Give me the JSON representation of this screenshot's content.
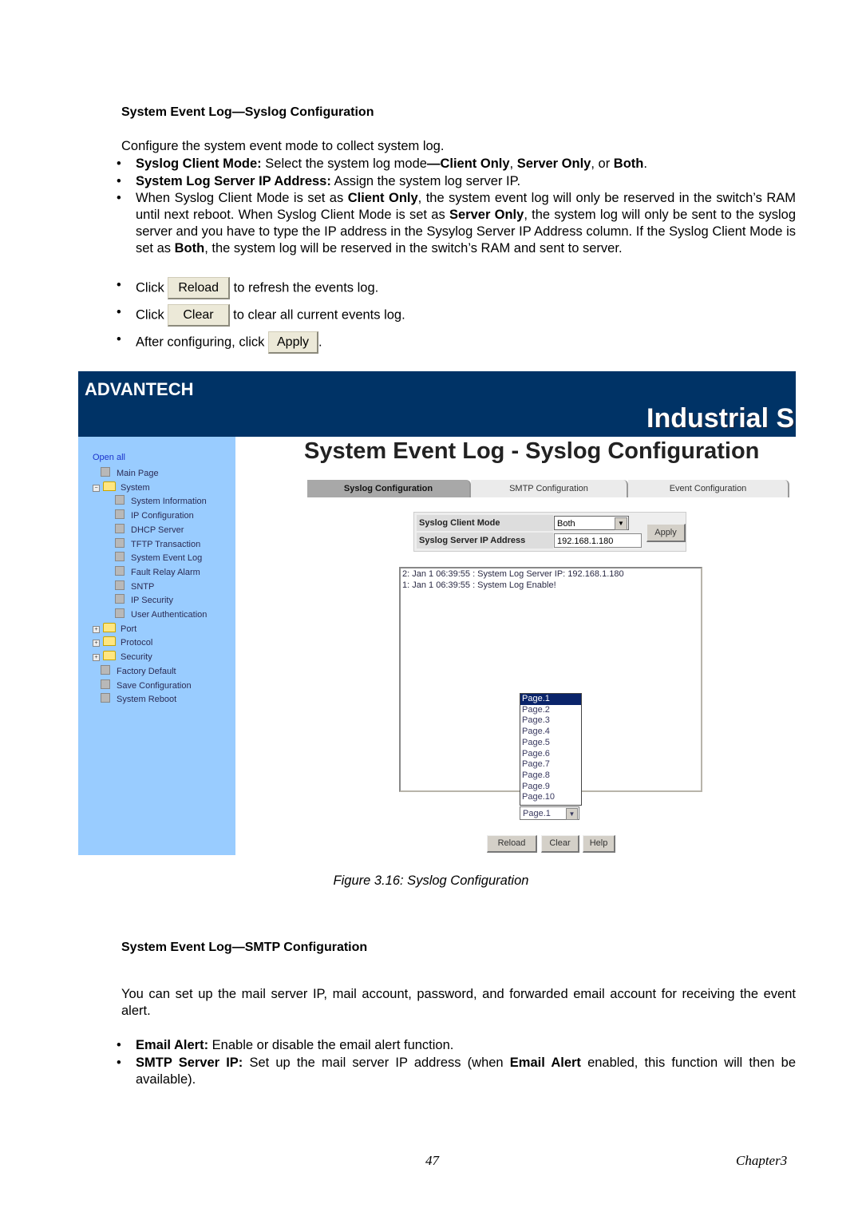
{
  "section1": {
    "heading": "System Event Log—Syslog Configuration",
    "intro": "Configure the system event mode to collect system log.",
    "bullets": {
      "b1_bold": "Syslog Client Mode:",
      "b1_text": " Select the system log mode",
      "b1_bold2": "—Client Only",
      "b1_sep1": ", ",
      "b1_bold3": "Server Only",
      "b1_sep2": ", or ",
      "b1_bold4": "Both",
      "b1_end": ".",
      "b2_bold": "System Log Server IP Address:",
      "b2_text": " Assign the system log server IP.",
      "b3_a": "When Syslog Client Mode is set as ",
      "b3_bold1": "Client Only",
      "b3_b": ", the system event log will only be reserved in the switch’s RAM until next reboot. When Syslog Client Mode is set as ",
      "b3_bold2": "Server Only",
      "b3_c": ", the system log will only be sent to the syslog server and you have to type the IP address in the Sysylog Server IP Address column. If the Syslog Client Mode is set as ",
      "b3_bold3": "Both",
      "b3_d": ", the system log will be reserved in the switch’s RAM and sent to server.",
      "b4_pre": "Click",
      "b4_btn": "Reload",
      "b4_post": "to refresh the events log.",
      "b5_pre": "Click",
      "b5_btn": "Clear",
      "b5_post": "to clear all current events log.",
      "b6_pre": "After configuring, click",
      "b6_btn": "Apply",
      "b6_post": "."
    }
  },
  "screenshot": {
    "logo": "ADVANTECH",
    "banner_title": "Industrial S",
    "page_title": "System Event Log - Syslog Configuration",
    "sidebar": {
      "open_all": "Open all",
      "items": [
        {
          "label": "Main Page",
          "type": "page",
          "level": 1
        },
        {
          "label": "System",
          "type": "folder-open",
          "level": 0
        },
        {
          "label": "System Information",
          "type": "page",
          "level": 2
        },
        {
          "label": "IP Configuration",
          "type": "page",
          "level": 2
        },
        {
          "label": "DHCP Server",
          "type": "page",
          "level": 2
        },
        {
          "label": "TFTP Transaction",
          "type": "page",
          "level": 2
        },
        {
          "label": "System Event Log",
          "type": "page",
          "level": 2
        },
        {
          "label": "Fault Relay Alarm",
          "type": "page",
          "level": 2
        },
        {
          "label": "SNTP",
          "type": "page",
          "level": 2
        },
        {
          "label": "IP Security",
          "type": "page",
          "level": 2
        },
        {
          "label": "User Authentication",
          "type": "page",
          "level": 2
        },
        {
          "label": "Port",
          "type": "folder",
          "level": 0
        },
        {
          "label": "Protocol",
          "type": "folder",
          "level": 0
        },
        {
          "label": "Security",
          "type": "folder",
          "level": 0
        },
        {
          "label": "Factory Default",
          "type": "page",
          "level": 1
        },
        {
          "label": "Save Configuration",
          "type": "page",
          "level": 1
        },
        {
          "label": "System Reboot",
          "type": "page",
          "level": 1
        }
      ]
    },
    "tabs": [
      {
        "label": "Syslog Configuration",
        "active": true
      },
      {
        "label": "SMTP Configuration",
        "active": false
      },
      {
        "label": "Event Configuration",
        "active": false
      }
    ],
    "form": {
      "client_mode_label": "Syslog Client Mode",
      "client_mode_value": "Both",
      "server_ip_label": "Syslog Server IP Address",
      "server_ip_value": "192.168.1.180",
      "apply_label": "Apply"
    },
    "log_lines": [
      "2: Jan 1 06:39:55 : System Log Server IP: 192.168.1.180",
      "1: Jan 1 06:39:55 : System Log Enable!"
    ],
    "page_options": [
      "Page.1",
      "Page.2",
      "Page.3",
      "Page.4",
      "Page.5",
      "Page.6",
      "Page.7",
      "Page.8",
      "Page.9",
      "Page.10"
    ],
    "page_selected": "Page.1",
    "buttons": {
      "reload": "Reload",
      "clear": "Clear",
      "help": "Help"
    }
  },
  "caption": "Figure 3.16: Syslog Configuration",
  "section2": {
    "heading": "System Event Log—SMTP Configuration",
    "intro": "You can set up the mail server IP, mail account, password, and forwarded email account for receiving the event alert.",
    "b1_bold": "Email Alert:",
    "b1_text": " Enable or disable the email alert function.",
    "b2_bold": "SMTP Server IP:",
    "b2_a": " Set up the mail server IP address (when ",
    "b2_bold2": "Email Alert",
    "b2_b": " enabled, this function will then be available)."
  },
  "footer": {
    "page_number": "47",
    "chapter": "Chapter3"
  },
  "colors": {
    "banner": "#003366",
    "sidebar": "#99ccff",
    "selected_option": "#0a246a"
  }
}
